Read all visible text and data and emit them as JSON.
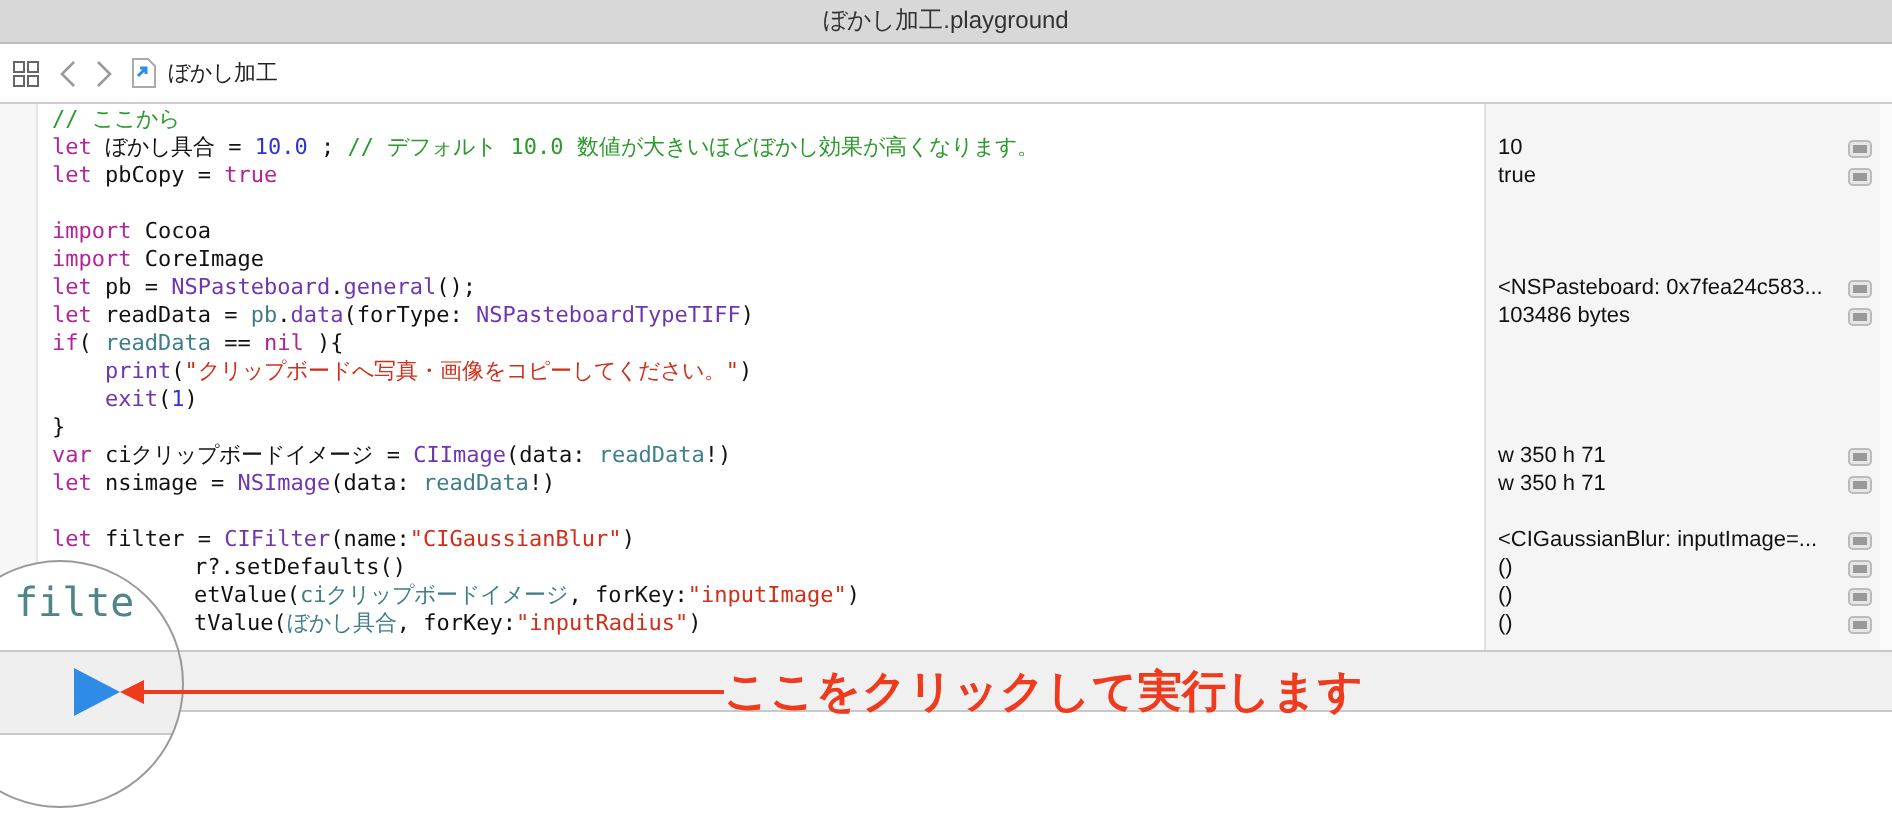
{
  "window": {
    "title": "ぼかし加工.playground"
  },
  "toolbar": {
    "file_name": "ぼかし加工"
  },
  "lines": [
    {
      "kind": "code",
      "segments": [
        {
          "kind": "comment",
          "t": "// ここから"
        }
      ]
    },
    {
      "kind": "code",
      "segments": [
        {
          "kind": "kw",
          "t": "let"
        },
        {
          "kind": "plain",
          "t": " ぼかし具合 = "
        },
        {
          "kind": "num",
          "t": "10.0"
        },
        {
          "kind": "plain",
          "t": " ; "
        },
        {
          "kind": "comment",
          "t": "// デフォルト 10.0 数値が大きいほどぼかし効果が高くなります。"
        }
      ],
      "result": "10"
    },
    {
      "kind": "code",
      "segments": [
        {
          "kind": "kw",
          "t": "let"
        },
        {
          "kind": "plain",
          "t": " pbCopy = "
        },
        {
          "kind": "kw",
          "t": "true"
        }
      ],
      "result": "true"
    },
    {
      "kind": "blank"
    },
    {
      "kind": "code",
      "segments": [
        {
          "kind": "kw",
          "t": "import"
        },
        {
          "kind": "plain",
          "t": " Cocoa"
        }
      ]
    },
    {
      "kind": "code",
      "segments": [
        {
          "kind": "kw",
          "t": "import"
        },
        {
          "kind": "plain",
          "t": " CoreImage"
        }
      ]
    },
    {
      "kind": "code",
      "segments": [
        {
          "kind": "kw",
          "t": "let"
        },
        {
          "kind": "plain",
          "t": " pb = "
        },
        {
          "kind": "type",
          "t": "NSPasteboard"
        },
        {
          "kind": "plain",
          "t": "."
        },
        {
          "kind": "type",
          "t": "general"
        },
        {
          "kind": "plain",
          "t": "();"
        }
      ],
      "result": "<NSPasteboard: 0x7fea24c583..."
    },
    {
      "kind": "code",
      "segments": [
        {
          "kind": "kw",
          "t": "let"
        },
        {
          "kind": "plain",
          "t": " readData = "
        },
        {
          "kind": "var",
          "t": "pb"
        },
        {
          "kind": "plain",
          "t": "."
        },
        {
          "kind": "type",
          "t": "data"
        },
        {
          "kind": "plain",
          "t": "(forType: "
        },
        {
          "kind": "type",
          "t": "NSPasteboardTypeTIFF"
        },
        {
          "kind": "plain",
          "t": ")"
        }
      ],
      "result": "103486 bytes"
    },
    {
      "kind": "code",
      "segments": [
        {
          "kind": "kw",
          "t": "if"
        },
        {
          "kind": "plain",
          "t": "( "
        },
        {
          "kind": "var",
          "t": "readData"
        },
        {
          "kind": "plain",
          "t": " == "
        },
        {
          "kind": "kw",
          "t": "nil"
        },
        {
          "kind": "plain",
          "t": " ){"
        }
      ]
    },
    {
      "kind": "code",
      "indented": true,
      "segments": [
        {
          "kind": "type",
          "t": "print"
        },
        {
          "kind": "plain",
          "t": "("
        },
        {
          "kind": "str",
          "t": "\"クリップボードへ写真・画像をコピーしてください。\""
        },
        {
          "kind": "plain",
          "t": ")"
        }
      ]
    },
    {
      "kind": "code",
      "indented": true,
      "segments": [
        {
          "kind": "type",
          "t": "exit"
        },
        {
          "kind": "plain",
          "t": "("
        },
        {
          "kind": "num",
          "t": "1"
        },
        {
          "kind": "plain",
          "t": ")"
        }
      ]
    },
    {
      "kind": "code",
      "segments": [
        {
          "kind": "plain",
          "t": "}"
        }
      ]
    },
    {
      "kind": "code",
      "segments": [
        {
          "kind": "kw",
          "t": "var"
        },
        {
          "kind": "plain",
          "t": " ciクリップボードイメージ = "
        },
        {
          "kind": "type",
          "t": "CIImage"
        },
        {
          "kind": "plain",
          "t": "(data: "
        },
        {
          "kind": "var",
          "t": "readData"
        },
        {
          "kind": "plain",
          "t": "!)"
        }
      ],
      "result": "w 350 h 71"
    },
    {
      "kind": "code",
      "segments": [
        {
          "kind": "kw",
          "t": "let"
        },
        {
          "kind": "plain",
          "t": " nsimage = "
        },
        {
          "kind": "type",
          "t": "NSImage"
        },
        {
          "kind": "plain",
          "t": "(data: "
        },
        {
          "kind": "var",
          "t": "readData"
        },
        {
          "kind": "plain",
          "t": "!)"
        }
      ],
      "result": "w 350 h 71"
    },
    {
      "kind": "blank"
    },
    {
      "kind": "code",
      "segments": [
        {
          "kind": "kw",
          "t": "let"
        },
        {
          "kind": "plain",
          "t": " filter = "
        },
        {
          "kind": "type",
          "t": "CIFilter"
        },
        {
          "kind": "plain",
          "t": "(name:"
        },
        {
          "kind": "str",
          "t": "\"CIGaussianBlur\""
        },
        {
          "kind": "plain",
          "t": ")"
        }
      ],
      "result": "<CIGaussianBlur: inputImage=..."
    },
    {
      "kind": "partial",
      "segments": [
        {
          "kind": "plain",
          "t": "r?.setDefaults()"
        }
      ],
      "result": "()"
    },
    {
      "kind": "partial",
      "segments": [
        {
          "kind": "plain",
          "t": "etValue("
        },
        {
          "kind": "var",
          "t": "ciクリップボードイメージ"
        },
        {
          "kind": "plain",
          "t": ", forKey:"
        },
        {
          "kind": "str",
          "t": "\"inputImage\""
        },
        {
          "kind": "plain",
          "t": ")"
        }
      ],
      "result": "()"
    },
    {
      "kind": "partial",
      "segments": [
        {
          "kind": "plain",
          "t": "tValue("
        },
        {
          "kind": "var",
          "t": "ぼかし具合"
        },
        {
          "kind": "plain",
          "t": ", forKey:"
        },
        {
          "kind": "str",
          "t": "\"inputRadius\""
        },
        {
          "kind": "plain",
          "t": ")"
        }
      ],
      "result": "()"
    }
  ],
  "magnifier": {
    "text": "filte"
  },
  "annotation": {
    "text": "ここをクリックして実行します"
  }
}
